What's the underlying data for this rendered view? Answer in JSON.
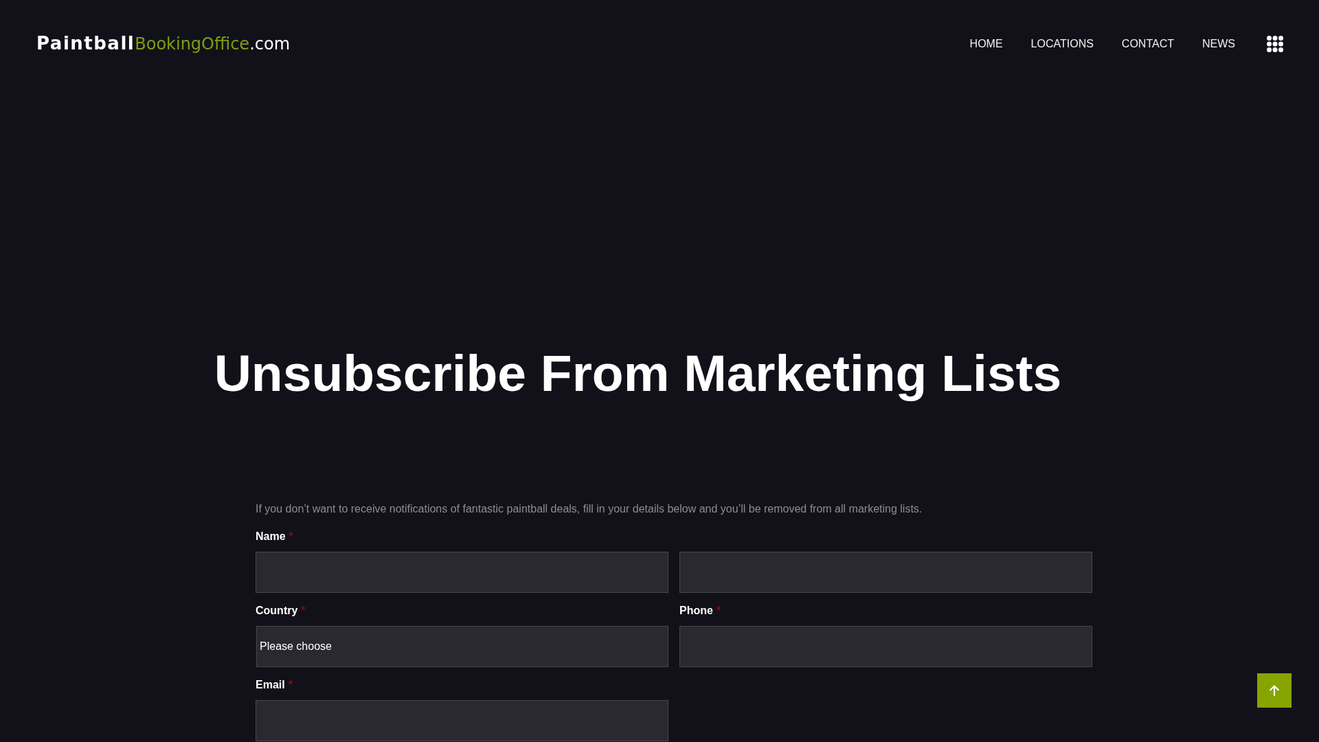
{
  "header": {
    "logo": [
      {
        "text": "Paintball",
        "kind": "heavy"
      },
      {
        "text": "BookingOffice",
        "kind": "accent"
      },
      {
        "text": ".com",
        "kind": "plain"
      }
    ],
    "nav": [
      {
        "label": "HOME"
      },
      {
        "label": "LOCATIONS"
      },
      {
        "label": "CONTACT"
      },
      {
        "label": "NEWS"
      }
    ]
  },
  "title": "Unsubscribe From Marketing Lists",
  "form": {
    "intro": "If you don’t want to receive notifications of fantastic paintball deals, fill in your details below and you’ll be removed from all marketing lists.",
    "required_mark": "*",
    "fields": [
      {
        "kind": "text-pair",
        "label": "Name",
        "required": true
      },
      {
        "kind": "select",
        "label": "Country",
        "required": true,
        "value": "Please choose"
      },
      {
        "kind": "text",
        "label": "Phone",
        "required": true
      },
      {
        "kind": "text",
        "label": "Email",
        "required": true
      }
    ]
  }
}
